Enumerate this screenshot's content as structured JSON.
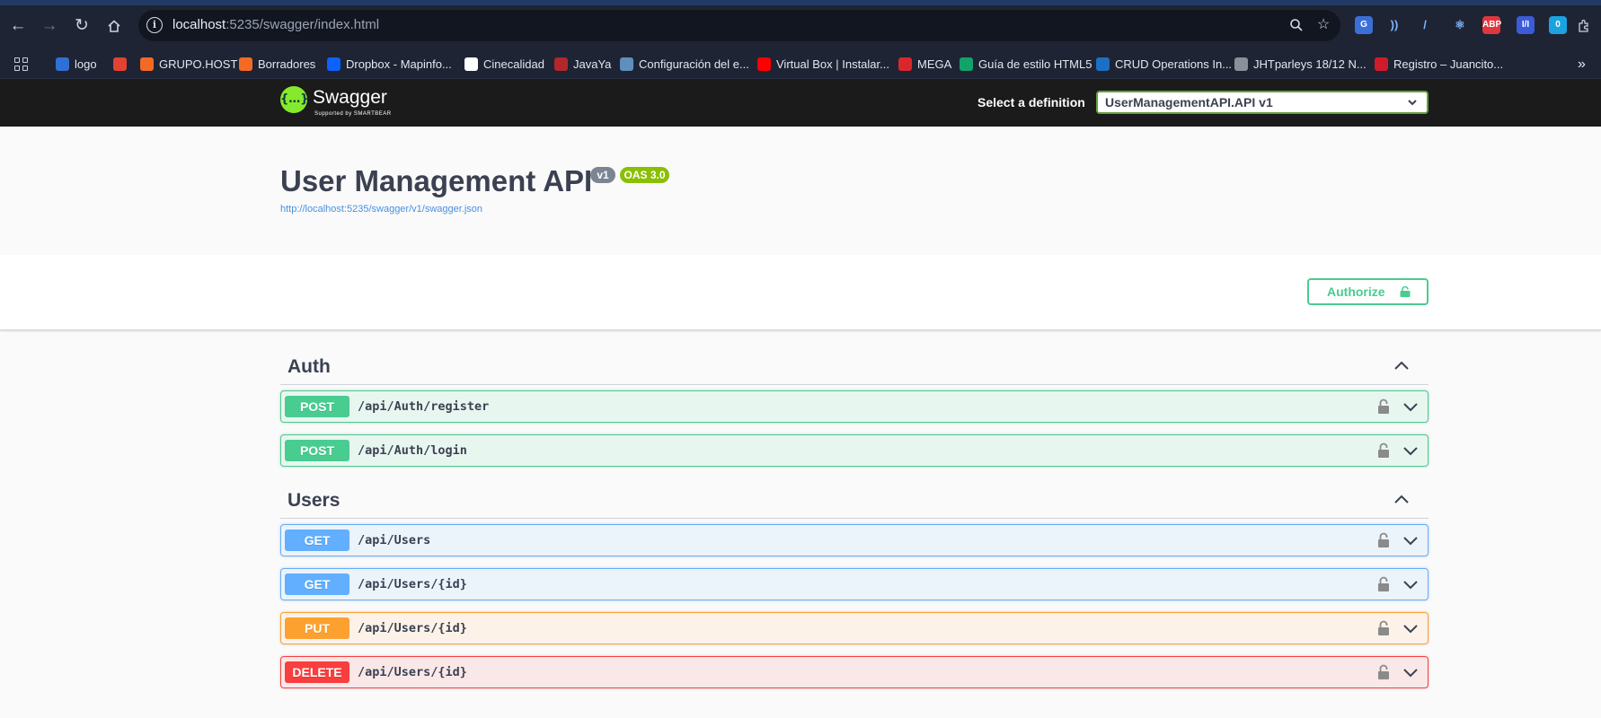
{
  "browser": {
    "url_host": "localhost",
    "url_rest": ":5235/swagger/index.html",
    "bookmarks": [
      {
        "label": "logo",
        "color": "#2f6fd6"
      },
      {
        "label": "",
        "color": "#e34133"
      },
      {
        "label": "GRUPO.HOST",
        "color": "#f46a25"
      },
      {
        "label": "Borradores",
        "color": "#f46a25"
      },
      {
        "label": "Dropbox - Mapinfo...",
        "color": "#0d61ff"
      },
      {
        "label": "Cinecalidad",
        "color": "#ffffff"
      },
      {
        "label": "JavaYa",
        "color": "#b2272c"
      },
      {
        "label": "Configuración del e...",
        "color": "#5f8fbf"
      },
      {
        "label": "Virtual Box | Instalar...",
        "color": "#ff0000"
      },
      {
        "label": "MEGA",
        "color": "#d9272e"
      },
      {
        "label": "Guía de estilo HTML5",
        "color": "#12a36b"
      },
      {
        "label": "CRUD Operations In...",
        "color": "#1b6fc4"
      },
      {
        "label": "JHTparleys 18/12 N...",
        "color": "#8a8f99"
      },
      {
        "label": "Registro – Juancito...",
        "color": "#d11b2a"
      }
    ],
    "extensions": [
      {
        "name": "translate-extension",
        "text": "G",
        "color": "#3b6fd8"
      },
      {
        "name": "wifi-extension",
        "text": "))",
        "color": "#1e2434"
      },
      {
        "name": "feather-extension",
        "text": "/",
        "color": "#1e2434"
      },
      {
        "name": "react-devtools-extension",
        "text": "⚛",
        "color": "#1e2434"
      },
      {
        "name": "adblock-extension",
        "text": "ABP",
        "color": "#e0373f"
      },
      {
        "name": "code-extension",
        "text": "I/I",
        "color": "#3b5bd8"
      },
      {
        "name": "badge-extension",
        "text": "0",
        "color": "#1ba3e0"
      }
    ]
  },
  "topbar": {
    "logo_text": "Swagger",
    "logo_sub": "Supported by SMARTBEAR",
    "select_label": "Select a definition",
    "selected_definition": "UserManagementAPI.API v1"
  },
  "info": {
    "title": "User Management API",
    "version_badge": "v1",
    "oas_badge": "OAS 3.0",
    "spec_url": "http://localhost:5235/swagger/v1/swagger.json"
  },
  "authorize_label": "Authorize",
  "tags": [
    {
      "name": "Auth",
      "operations": [
        {
          "method": "POST",
          "path": "/api/Auth/register"
        },
        {
          "method": "POST",
          "path": "/api/Auth/login"
        }
      ]
    },
    {
      "name": "Users",
      "operations": [
        {
          "method": "GET",
          "path": "/api/Users"
        },
        {
          "method": "GET",
          "path": "/api/Users/{id}"
        },
        {
          "method": "PUT",
          "path": "/api/Users/{id}"
        },
        {
          "method": "DELETE",
          "path": "/api/Users/{id}"
        }
      ]
    }
  ],
  "colors": {
    "post": "#49cc90",
    "get": "#61affe",
    "put": "#fca130",
    "delete": "#f93e3e",
    "swagger_green": "#85ea2d"
  }
}
